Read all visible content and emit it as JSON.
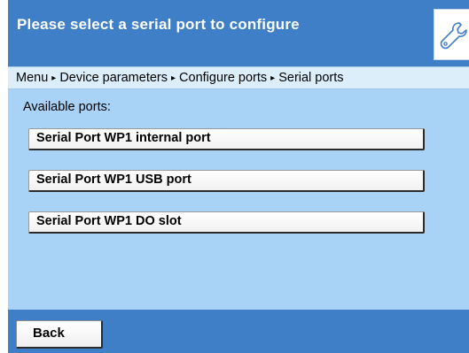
{
  "header": {
    "title": "Please select a serial port to configure",
    "icon": "wrench-icon"
  },
  "breadcrumb": {
    "items": [
      "Menu",
      "Device parameters",
      "Configure ports",
      "Serial ports"
    ],
    "separator": "▸"
  },
  "main": {
    "available_label": "Available ports:",
    "ports": [
      {
        "label": "Serial Port WP1 internal port"
      },
      {
        "label": "Serial Port WP1 USB port"
      },
      {
        "label": "Serial Port WP1 DO slot"
      }
    ]
  },
  "footer": {
    "back_label": "Back"
  },
  "colors": {
    "header_blue": "#3f7fc7",
    "content_blue": "#a9d3f6",
    "breadcrumb_bg": "#ddeefb"
  }
}
